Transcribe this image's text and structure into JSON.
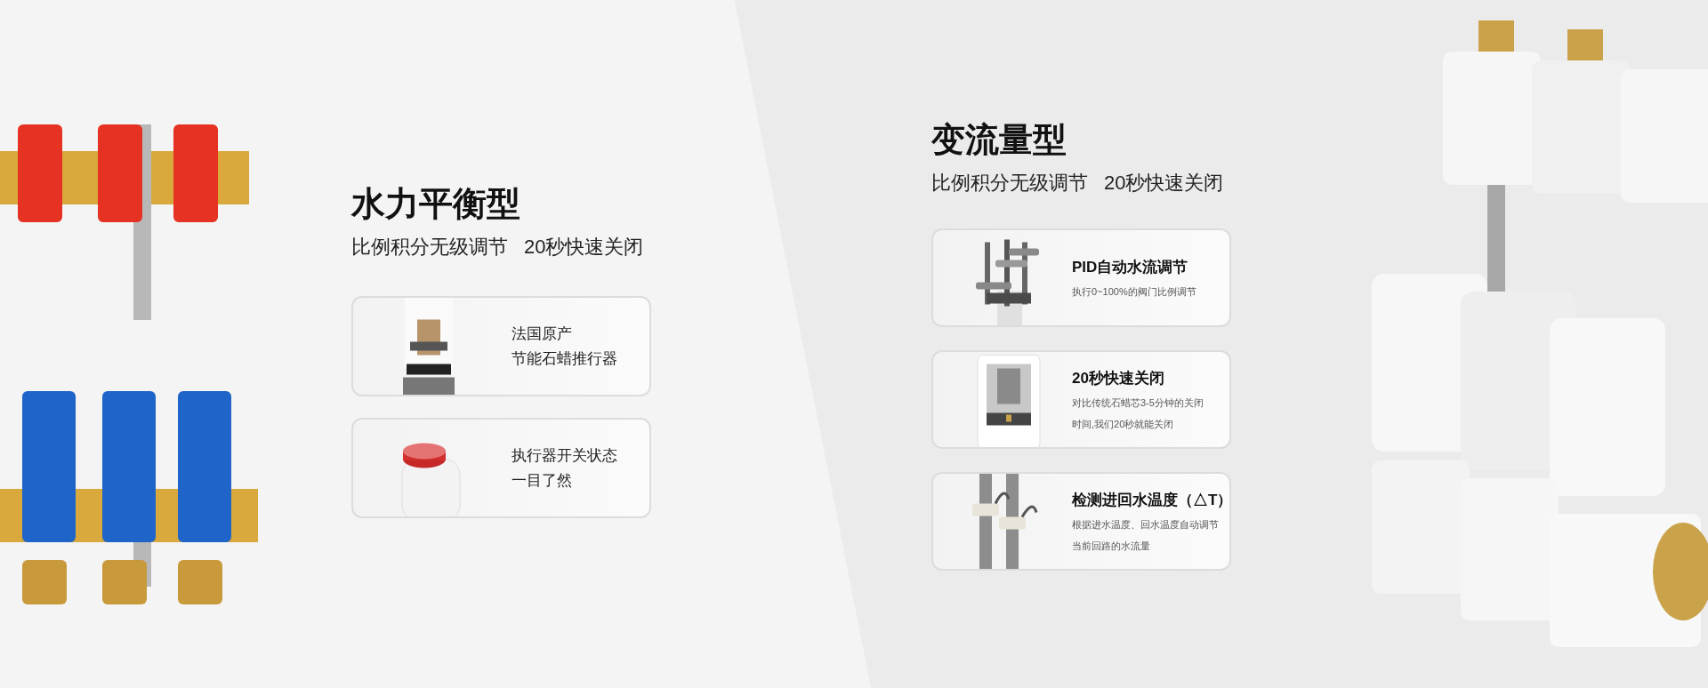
{
  "sections": [
    {
      "title": "水力平衡型",
      "subtitle": [
        "比例积分无级调节",
        "20秒快速关闭"
      ],
      "cards": [
        {
          "kind": "plain",
          "lines": [
            "法国原产",
            "节能石蜡推行器"
          ]
        },
        {
          "kind": "plain",
          "lines": [
            "执行器开关状态",
            "一目了然"
          ]
        }
      ]
    },
    {
      "title": "变流量型",
      "subtitle": [
        "比例积分无级调节",
        "20秒快速关闭"
      ],
      "cards": [
        {
          "kind": "titled",
          "title": "PID自动水流调节",
          "lines": [
            "执行0~100%的阀门比例调节"
          ]
        },
        {
          "kind": "titled",
          "title": "20秒快速关闭",
          "lines": [
            "对比传统石蜡芯3-5分钟的关闭",
            "时间,我们20秒就能关闭"
          ]
        },
        {
          "kind": "titled",
          "title": "检测进回水温度（△T）",
          "lines": [
            "根据进水温度、回水温度自动调节",
            "当前回路的水流量"
          ]
        }
      ]
    }
  ]
}
